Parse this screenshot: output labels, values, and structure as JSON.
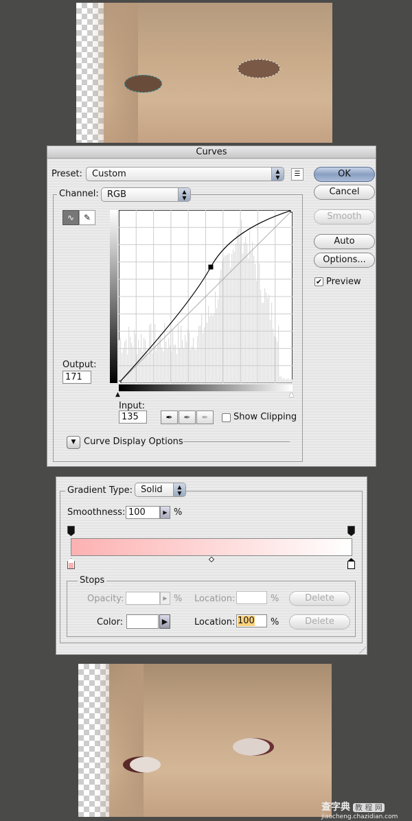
{
  "curves": {
    "title": "Curves",
    "preset_label": "Preset:",
    "preset_value": "Custom",
    "channel_label": "Channel:",
    "channel_value": "RGB",
    "buttons": {
      "ok": "OK",
      "cancel": "Cancel",
      "smooth": "Smooth",
      "auto": "Auto",
      "options": "Options..."
    },
    "preview_label": "Preview",
    "preview_checked": true,
    "output_label": "Output:",
    "output_value": "171",
    "input_label": "Input:",
    "input_value": "135",
    "show_clipping_label": "Show Clipping",
    "show_clipping_checked": false,
    "curve_display_options_label": "Curve Display Options",
    "curve_points": [
      [
        0,
        0
      ],
      [
        135,
        171
      ],
      [
        255,
        255
      ]
    ]
  },
  "gradient": {
    "type_label": "Gradient Type:",
    "type_value": "Solid",
    "smoothness_label": "Smoothness:",
    "smoothness_value": "100",
    "percent": "%",
    "start_color": "#fdb1b1",
    "end_color": "#ffffff",
    "stops": {
      "title": "Stops",
      "opacity_label": "Opacity:",
      "opacity_value": "",
      "location_label": "Location:",
      "opacity_location_value": "",
      "delete_label": "Delete",
      "color_label": "Color:",
      "color_value": "#ffffff",
      "color_location_value": "100"
    }
  },
  "watermark": {
    "brand": "查字典",
    "tag": "教 程 网",
    "url": "jiaocheng.chazidian.com"
  }
}
